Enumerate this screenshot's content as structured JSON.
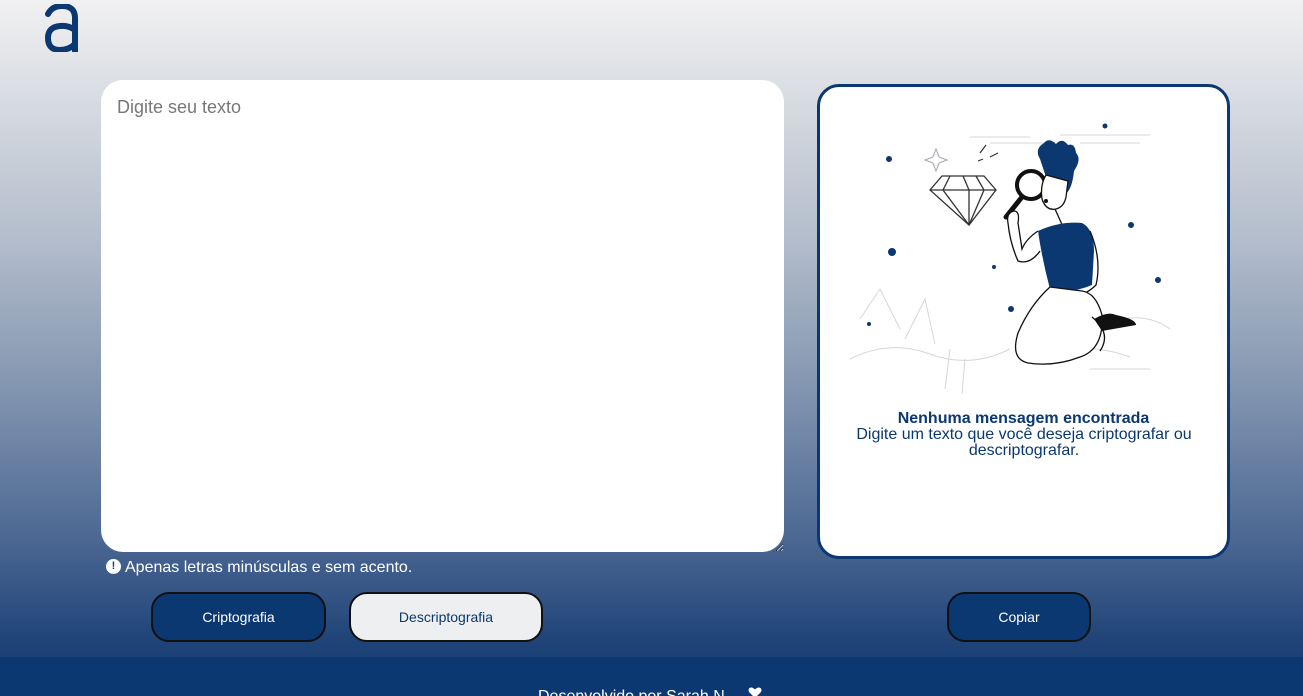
{
  "brand": {
    "logo_icon": "letter-a-logo",
    "color": "#0b3871"
  },
  "input": {
    "placeholder": "Digite seu texto",
    "value": ""
  },
  "warning": {
    "icon": "exclamation-circle-icon",
    "text": "Apenas letras minúsculas e sem acento."
  },
  "buttons": {
    "encrypt_label": "Criptografia",
    "decrypt_label": "Descriptografia",
    "copy_label": "Copiar"
  },
  "output": {
    "illustration": "person-with-magnifying-glass-and-diamond",
    "title": "Nenhuma mensagem encontrada",
    "subtitle": "Digite um texto que você deseja criptografar ou descriptografar."
  },
  "footer": {
    "text": "Desenvolvido por Sarah N"
  },
  "colors": {
    "accent": "#0b3871",
    "light_button": "#eeeff1"
  }
}
